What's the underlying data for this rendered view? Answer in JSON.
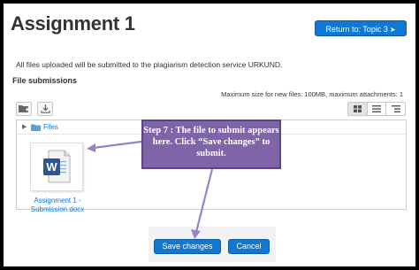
{
  "page": {
    "title": "Assignment 1",
    "return_button": "Return to: Topic 3",
    "notice": "All files uploaded will be submitted to the plagiarism detection service URKUND.",
    "section_heading": "File submissions",
    "max_size_text": "Maximum size for new files: 100MB, maximum attachments: 1"
  },
  "filemanager": {
    "path_label": "Files",
    "file_name": "Assignment 1 - Submission.docx",
    "file_name_visible": "Assignment 1 - Submission.docx",
    "view_modes": [
      "icons",
      "list",
      "tree"
    ],
    "selected_view": "icons"
  },
  "callout": {
    "text": "Step 7 : The file to submit appears here. Click “Save changes” to submit."
  },
  "buttons": {
    "save": "Save changes",
    "cancel": "Cancel"
  },
  "colors": {
    "primary": "#1177d1",
    "callout_fill": "#7f64a8",
    "arrow": "#9a82c4"
  }
}
